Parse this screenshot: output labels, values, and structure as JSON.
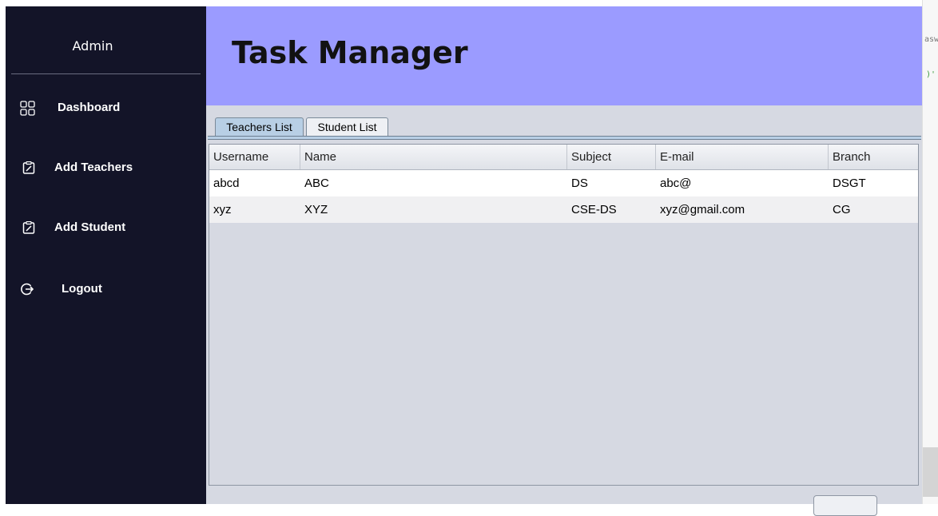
{
  "sidebar": {
    "title": "Admin",
    "items": [
      {
        "label": "Dashboard",
        "icon": "dashboard-grid-icon"
      },
      {
        "label": "Add Teachers",
        "icon": "clipboard-edit-icon"
      },
      {
        "label": "Add Student",
        "icon": "clipboard-edit-icon"
      },
      {
        "label": "Logout",
        "icon": "logout-icon"
      }
    ]
  },
  "header": {
    "title": "Task Manager"
  },
  "tabs": [
    {
      "label": "Teachers List",
      "selected": true
    },
    {
      "label": "Student List",
      "selected": false
    }
  ],
  "table": {
    "columns": [
      "Username",
      "Name",
      "Subject",
      "E-mail",
      "Branch"
    ],
    "rows": [
      [
        "abcd",
        "ABC",
        "DS",
        "abc@",
        "DSGT"
      ],
      [
        "xyz",
        "XYZ",
        "CSE-DS",
        "xyz@gmail.com",
        "CG"
      ]
    ]
  },
  "background_code": {
    "fragment_1": "asw",
    "fragment_2": ")'"
  },
  "colors": {
    "sidebar_bg": "#131428",
    "header_bg": "#9b9bff",
    "main_bg": "#d6d9e2",
    "selected_tab": "#b8cfe5",
    "accent_code": "#3a9a3a"
  }
}
